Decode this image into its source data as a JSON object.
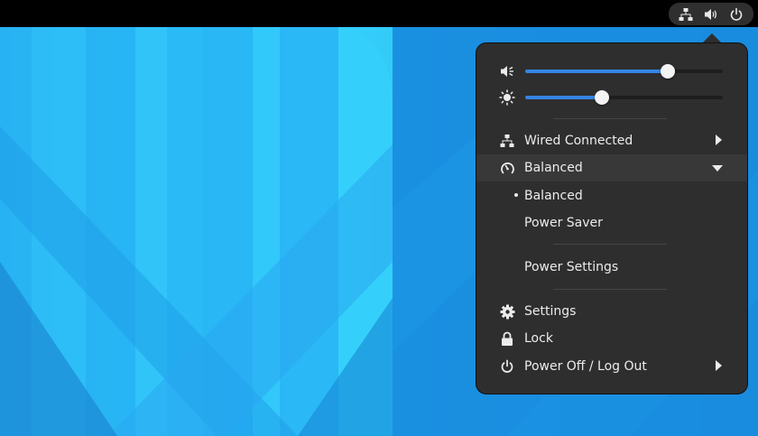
{
  "topbar": {
    "status_icons": [
      "network-wired-icon",
      "audio-volume-icon",
      "power-icon"
    ]
  },
  "menu": {
    "volume": {
      "icon": "speaker-icon",
      "level": 0.72
    },
    "brightness": {
      "icon": "brightness-icon",
      "level": 0.39
    },
    "wired": {
      "icon": "network-wired-icon",
      "label": "Wired Connected"
    },
    "power_mode": {
      "icon": "power-profile-icon",
      "label": "Balanced",
      "options": [
        {
          "label": "Balanced",
          "selected": true
        },
        {
          "label": "Power Saver",
          "selected": false
        }
      ],
      "settings_label": "Power Settings"
    },
    "settings": {
      "icon": "gear-icon",
      "label": "Settings"
    },
    "lock": {
      "icon": "lock-icon",
      "label": "Lock"
    },
    "power_off": {
      "icon": "power-icon",
      "label": "Power Off / Log Out"
    }
  },
  "colors": {
    "accent": "#3584e4",
    "menu_bg": "#2e2e2e",
    "topbar_bg": "#000000"
  }
}
